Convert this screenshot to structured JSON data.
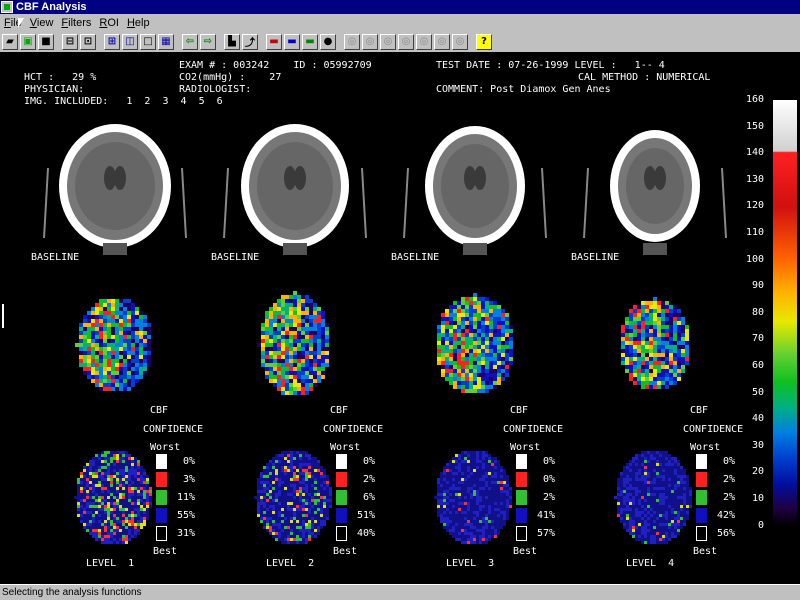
{
  "window": {
    "title": "CBF Analysis"
  },
  "menu": [
    "File",
    "View",
    "Filters",
    "ROI",
    "Help"
  ],
  "toolbar_icons": [
    "open-icon",
    "monitor-icon",
    "save-icon",
    "sep",
    "print-icon",
    "print-setup-icon",
    "sep",
    "grid-2x2-icon",
    "grid-2x1-icon",
    "single-view-icon",
    "grid-4x4-icon",
    "sep",
    "arrow-left-icon",
    "arrow-right-icon",
    "sep",
    "chart-icon",
    "export-icon",
    "sep",
    "red-monitor-icon",
    "blue-monitor-icon",
    "color-monitor-icon",
    "palette-icon",
    "sep",
    "tool-1-icon",
    "tool-2-icon",
    "tool-3-icon",
    "tool-4-icon",
    "tool-5-icon",
    "tool-6-icon",
    "tool-7-icon",
    "sep",
    "help-icon"
  ],
  "header": {
    "hct": "HCT :   29 %",
    "physician": "PHYSICIAN:",
    "images": "IMG. INCLUDED:   1  2  3  4  5  6",
    "exam": "EXAM # : 003242    ID : 05992709",
    "co2": "CO2(mmHg) :    27",
    "radiologist": "RADIOLOGIST:",
    "test_date": "TEST DATE : 07-26-1999 LEVEL :   1-- 4",
    "cal_method": "CAL METHOD : NUMERICAL",
    "comment": "COMMENT: Post Diamox Gen Anes"
  },
  "panels": [
    {
      "baseline": "BASELINE",
      "cbf": "CBF",
      "confidence": "CONFIDENCE",
      "worst": "Worst",
      "best": "Best",
      "level": "LEVEL  1",
      "pcts": [
        "0%",
        "3%",
        "11%",
        "55%",
        "31%"
      ]
    },
    {
      "baseline": "BASELINE",
      "cbf": "CBF",
      "confidence": "CONFIDENCE",
      "worst": "Worst",
      "best": "Best",
      "level": "LEVEL  2",
      "pcts": [
        "0%",
        "2%",
        "6%",
        "51%",
        "40%"
      ]
    },
    {
      "baseline": "BASELINE",
      "cbf": "CBF",
      "confidence": "CONFIDENCE",
      "worst": "Worst",
      "best": "Best",
      "level": "LEVEL  3",
      "pcts": [
        "0%",
        "0%",
        "2%",
        "41%",
        "57%"
      ]
    },
    {
      "baseline": "BASELINE",
      "cbf": "CBF",
      "confidence": "CONFIDENCE",
      "worst": "Worst",
      "best": "Best",
      "level": "LEVEL  4",
      "pcts": [
        "0%",
        "2%",
        "2%",
        "42%",
        "56%"
      ]
    }
  ],
  "confidence_colors": [
    "#ffffff",
    "#ff2020",
    "#30c030",
    "#1010c0",
    "#000000"
  ],
  "colorbar": {
    "ticks": [
      "160",
      "150",
      "140",
      "130",
      "120",
      "110",
      "100",
      "90",
      "80",
      "70",
      "60",
      "50",
      "40",
      "30",
      "20",
      "10",
      "0"
    ]
  },
  "status": "Selecting the analysis functions"
}
